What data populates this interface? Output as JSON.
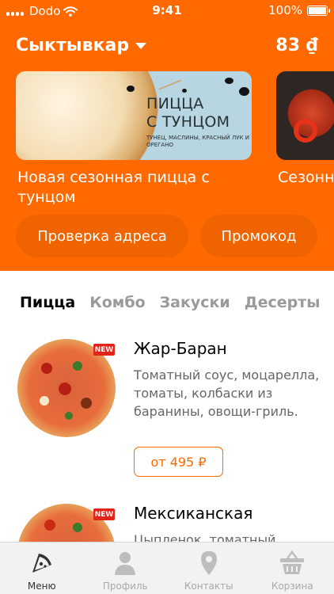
{
  "status_bar": {
    "carrier": "Dodo",
    "time": "9:41",
    "battery": "100%"
  },
  "header": {
    "city": "Сыктывкар",
    "coins": "83 ₫",
    "accent_color": "#ff6900"
  },
  "banners": [
    {
      "title_line1": "ПИЦЦА",
      "title_line2": "С ТУНЦОМ",
      "subtitle": "ТУНЕЦ, МАСЛИНЫ, КРАСНЫЙ ЛУК И ОРЕГАНО"
    }
  ],
  "promos": [
    {
      "title": "Новая сезонная пицца с тунцом"
    },
    {
      "title": "Сезонные"
    }
  ],
  "actions": {
    "address_check": "Проверка адреса",
    "promo_code": "Промокод"
  },
  "categories": [
    "Пицца",
    "Комбо",
    "Закуски",
    "Десерты"
  ],
  "products": [
    {
      "name": "Жар-Баран",
      "badge": "NEW",
      "description": "Томатный соус, моцарелла, томаты, колбаски из баранины, овощи-гриль.",
      "price": "от 495 ₽"
    },
    {
      "name": "Мексиканская",
      "badge": "NEW",
      "description": "Цыпленок, томатный"
    }
  ],
  "tabbar": [
    {
      "label": "Меню",
      "icon": "pizza-slice-icon"
    },
    {
      "label": "Профиль",
      "icon": "person-icon"
    },
    {
      "label": "Контакты",
      "icon": "map-pin-icon"
    },
    {
      "label": "Корзина",
      "icon": "basket-icon"
    }
  ]
}
